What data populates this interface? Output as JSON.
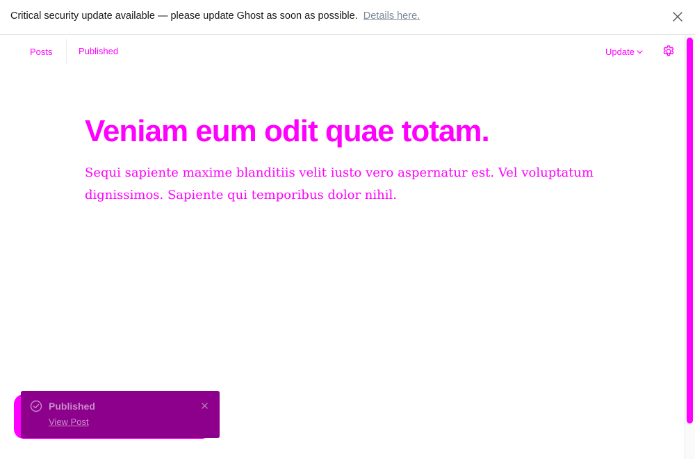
{
  "banner": {
    "message": "Critical security update available — please update Ghost as soon as possible.",
    "link_text": "Details here.",
    "close_icon": "close-icon"
  },
  "header": {
    "breadcrumb_posts": "Posts",
    "status": "Published",
    "update_label": "Update",
    "update_icon": "chevron-down-icon",
    "settings_icon": "gear-icon"
  },
  "post": {
    "title": "Veniam eum odit quae totam.",
    "excerpt": "Sequi sapiente maxime blanditiis velit iusto vero aspernatur est. Vel voluptatum dignissimos. Sapiente qui temporibus dolor nihil."
  },
  "toast": {
    "title": "Published",
    "link_text": "View Post",
    "check_icon": "check-circle-icon",
    "close_icon": "close-icon"
  },
  "colors": {
    "accent": "#ff00ff",
    "toast_bg": "#8c008c",
    "banner_text": "#15171a",
    "link_muted": "#7c8b9a"
  }
}
